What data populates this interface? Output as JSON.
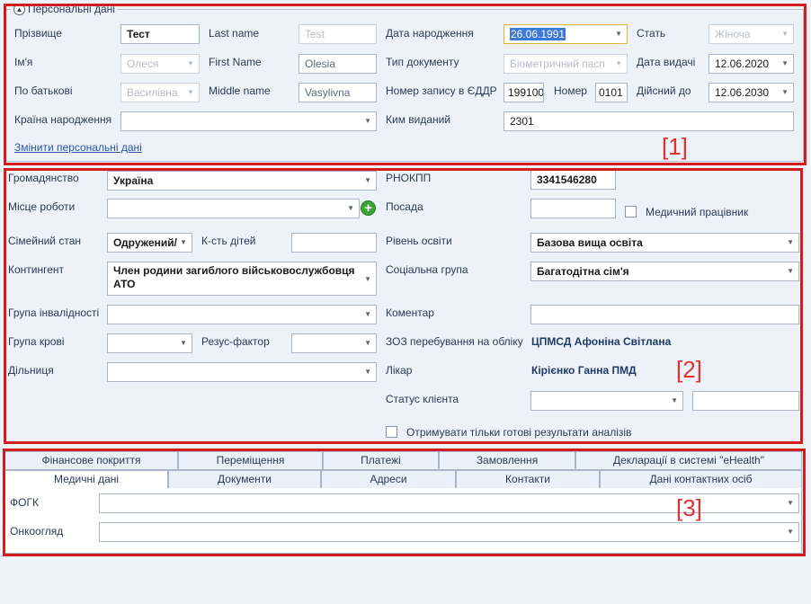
{
  "personal": {
    "legend": "Персональні дані",
    "surname_label": "Прізвище",
    "surname": "Тест",
    "name_label": "Ім'я",
    "name": "Олеся",
    "patronymic_label": "По батькові",
    "patronymic": "Василівна",
    "birth_country_label": "Країна народження",
    "birth_country": "",
    "lastname_label": "Last name",
    "lastname": "Test",
    "firstname_label": "First Name",
    "firstname": "Olesia",
    "middlename_label": "Middle name",
    "middlename": "Vasylivna",
    "birthdate_label": "Дата народження",
    "birthdate": "26.06.1991",
    "doctype_label": "Тип документу",
    "doctype": "Біометричний пасп",
    "record_label": "Номер запису в ЄДДР",
    "record": "199100",
    "number_label": "Номер",
    "number": "0101",
    "issued_by_label": "Ким виданий",
    "issued_by": "2301",
    "sex_label": "Стать",
    "sex": "Жіноча",
    "issue_date_label": "Дата видачі",
    "issue_date": "12.06.2020",
    "valid_to_label": "Дійсний до",
    "valid_to": "12.06.2030",
    "change_link": "Змінити персональні дані"
  },
  "general": {
    "citizenship_label": "Громадянство",
    "citizenship": "Україна",
    "workplace_label": "Місце роботи",
    "workplace": "",
    "marital_label": "Сімейний стан",
    "marital": "Одружений/",
    "children_label": "К-сть дітей",
    "children": "",
    "contingent_label": "Контингент",
    "contingent": "Член родини загиблого військовослужбовця АТО",
    "disability_label": "Група інвалідності",
    "disability": "",
    "blood_label": "Група крові",
    "blood": "",
    "rhesus_label": "Резус-фактор",
    "rhesus": "",
    "district_label": "Дільниця",
    "district": "",
    "rnokpp_label": "РНОКПП",
    "rnokpp": "3341546280",
    "position_label": "Посада",
    "position": "",
    "medical_worker_label": "Медичний працівник",
    "education_label": "Рівень освіти",
    "education": "Базова вища освіта",
    "social_label": "Соціальна група",
    "social": "Багатодітна сім'я",
    "comment_label": "Коментар",
    "comment": "",
    "zoz_label": "ЗОЗ перебування на обліку",
    "zoz": "ЦПМСД Афоніна Світлана",
    "doctor_label": "Лікар",
    "doctor": "Кірієнко Ганна ПМД",
    "client_status_label": "Статус клієнта",
    "client_status": "",
    "client_status_extra": "",
    "ready_results_label": "Отримувати тільки готові результати аналізів"
  },
  "tabs": {
    "row1": [
      "Фінансове покриття",
      "Переміщення",
      "Платежі",
      "Замовлення",
      "Декларації в системі \"eHealth\""
    ],
    "row2": [
      "Медичні дані",
      "Документи",
      "Адреси",
      "Контакти",
      "Дані контактних осіб"
    ]
  },
  "medical": {
    "fogk_label": "ФОГК",
    "fogk": "",
    "onko_label": "Онкоогляд",
    "onko": ""
  },
  "annotations": [
    "[1]",
    "[2]",
    "[3]"
  ],
  "colors": {
    "annotation": "#d31c1c",
    "accent": "#3c78d8",
    "plus": "#3aa63a"
  }
}
